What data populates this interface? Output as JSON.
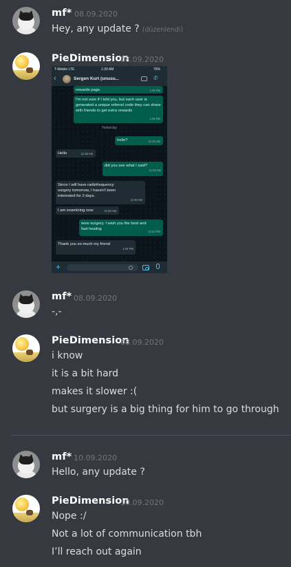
{
  "messages": [
    {
      "user": "mf*",
      "avatar": "cat-avatar",
      "timestamp": "08.09.2020",
      "lines": [
        "Hey, any update ?"
      ],
      "edited_note": "(düzenlendi)"
    },
    {
      "user": "PieDimension",
      "avatar": "landscape-avatar",
      "timestamp": "08.09.2020",
      "lines": [],
      "attachment": "whatsapp-screenshot"
    },
    {
      "user": "mf*",
      "avatar": "cat-avatar",
      "timestamp": "08.09.2020",
      "lines": [
        "-,-"
      ]
    },
    {
      "user": "PieDimension",
      "avatar": "landscape-avatar",
      "timestamp": "08.09.2020",
      "lines": [
        "i know",
        "it is a bit hard",
        "makes it slower :(",
        "but surgery is a big thing for him to go through"
      ]
    },
    {
      "user": "mf*",
      "avatar": "cat-avatar",
      "timestamp": "10.09.2020",
      "lines": [
        "Hello, any update ?"
      ]
    },
    {
      "user": "PieDimension",
      "avatar": "landscape-avatar",
      "timestamp": "10.09.2020",
      "lines": [
        "Nope :/",
        "Not a lot of communication tbh",
        "I’ll reach out again"
      ]
    }
  ],
  "phone": {
    "status": {
      "carrier": "T-Mobile  LTE",
      "time": "1:39 AM",
      "battery": "76%"
    },
    "contact_name": "Sergen Kurt (unusu...",
    "day_separator": "Yesterday",
    "bubbles": [
      {
        "dir": "out",
        "text": "rewards page.",
        "time": "1:34 PM"
      },
      {
        "dir": "out",
        "text": "I'm not sure if I told you, but each user is generated a unique referral code they can share with friends to get extra rewards",
        "time": "1:36 PM"
      },
      {
        "dir": "out",
        "text": "hello?",
        "time": "11:33 AM"
      },
      {
        "dir": "in",
        "text": "Hello",
        "time": "11:38 AM"
      },
      {
        "dir": "out",
        "text": "did you see what I said?",
        "time": "11:40 AM"
      },
      {
        "dir": "in",
        "text": "Since I will have radiofrequency surgery tomorrow, I haven't been interested for 2 days.",
        "time": "11:50 AM"
      },
      {
        "dir": "in",
        "text": "I am examining now",
        "time": "11:50 AM"
      },
      {
        "dir": "out",
        "text": "wow surgery. I wish you the best and fast healing",
        "time": "12:03 PM"
      },
      {
        "dir": "in",
        "text": "Thank you so much my friend",
        "time": "1:04 PM"
      }
    ]
  },
  "colors": {
    "background": "#36393f",
    "username": "#ffffff",
    "timestamp": "#72767d",
    "text": "#dcddde",
    "wa_out": "#005c4b",
    "wa_in": "#202c33",
    "wa_accent": "#53bdeb"
  }
}
